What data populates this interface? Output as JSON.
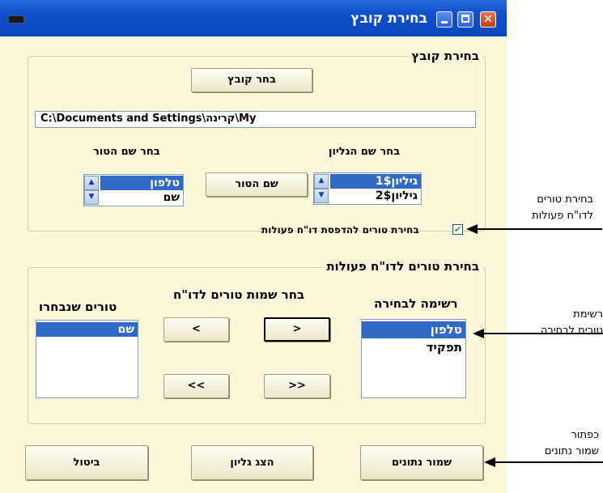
{
  "window": {
    "title": "בחירת קובץ"
  },
  "file_group": {
    "legend": "בחירת קובץ",
    "choose_file_button": "בחר קובץ",
    "path_value": "C:\\Documents and Settings\\קרינה\\My",
    "sheet_label": "בחר שם הגליון",
    "column_label": "בחר שם הטור",
    "column_name_button": "שם הטור",
    "sheets": [
      "גיליון1$",
      "גיליון2$"
    ],
    "columns": [
      "טלפון",
      "שם"
    ],
    "checkbox_label": "בחירת טורים להדפסת דו\"ח פעולות",
    "checkbox_checked": true
  },
  "columns_group": {
    "legend": "בחירת טורים לדו\"ח פעולות",
    "choose_names_label": "בחר שמות טורים לדו\"ח",
    "available_label": "רשימה לבחירה",
    "selected_label": "טורים  שנבחרו",
    "available_items": [
      "טלפון",
      "תפקיד"
    ],
    "selected_items": [
      "שם"
    ],
    "btn_move_right": ">",
    "btn_move_left": "<",
    "btn_move_all_right": ">>",
    "btn_move_all_left": "<<"
  },
  "footer": {
    "save_button": "שמור נתונים",
    "show_sheet_button": "הצג גליון",
    "cancel_button": "ביטול"
  },
  "annotations": {
    "columns_select": [
      "בחירת טורים",
      "לדו\"ח פעולות"
    ],
    "list_select": [
      "רשימת",
      "טורים לבחירה"
    ],
    "save_button_note": [
      "כפתור",
      "שמור נתונים"
    ]
  }
}
